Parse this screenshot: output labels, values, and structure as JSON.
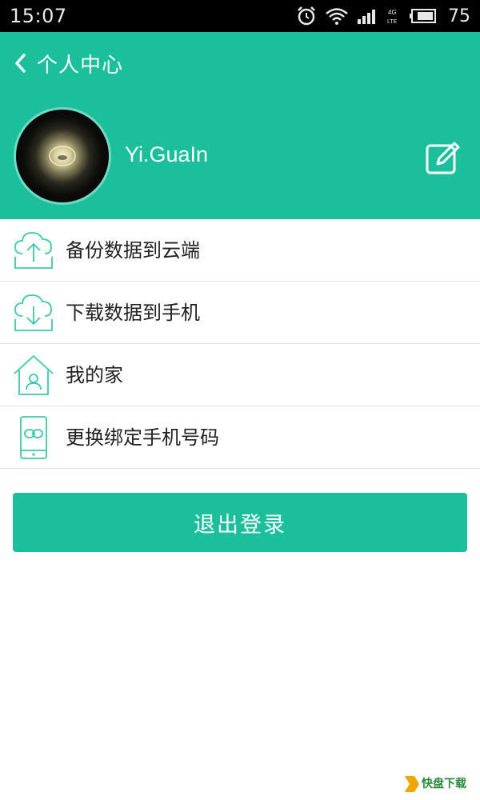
{
  "status_bar": {
    "time": "15:07",
    "network": "4G LTE",
    "battery": "75",
    "icons": [
      "alarm-icon",
      "wifi-icon",
      "signal-icon",
      "battery-icon"
    ]
  },
  "nav": {
    "back_icon": "chevron-left-icon",
    "title": "个人中心"
  },
  "profile": {
    "username": "Yi.GuaIn",
    "edit_icon": "edit-icon"
  },
  "menu": {
    "items": [
      {
        "icon": "cloud-upload-icon",
        "label": "备份数据到云端"
      },
      {
        "icon": "cloud-download-icon",
        "label": "下载数据到手机"
      },
      {
        "icon": "home-icon",
        "label": "我的家"
      },
      {
        "icon": "phone-bind-icon",
        "label": "更换绑定手机号码"
      }
    ]
  },
  "logout": {
    "label": "退出登录"
  },
  "watermark": {
    "text": "快盘下载"
  },
  "colors": {
    "accent": "#1cbf9b",
    "icon_stroke": "#3cc9ab",
    "status_bar": "#000000"
  }
}
